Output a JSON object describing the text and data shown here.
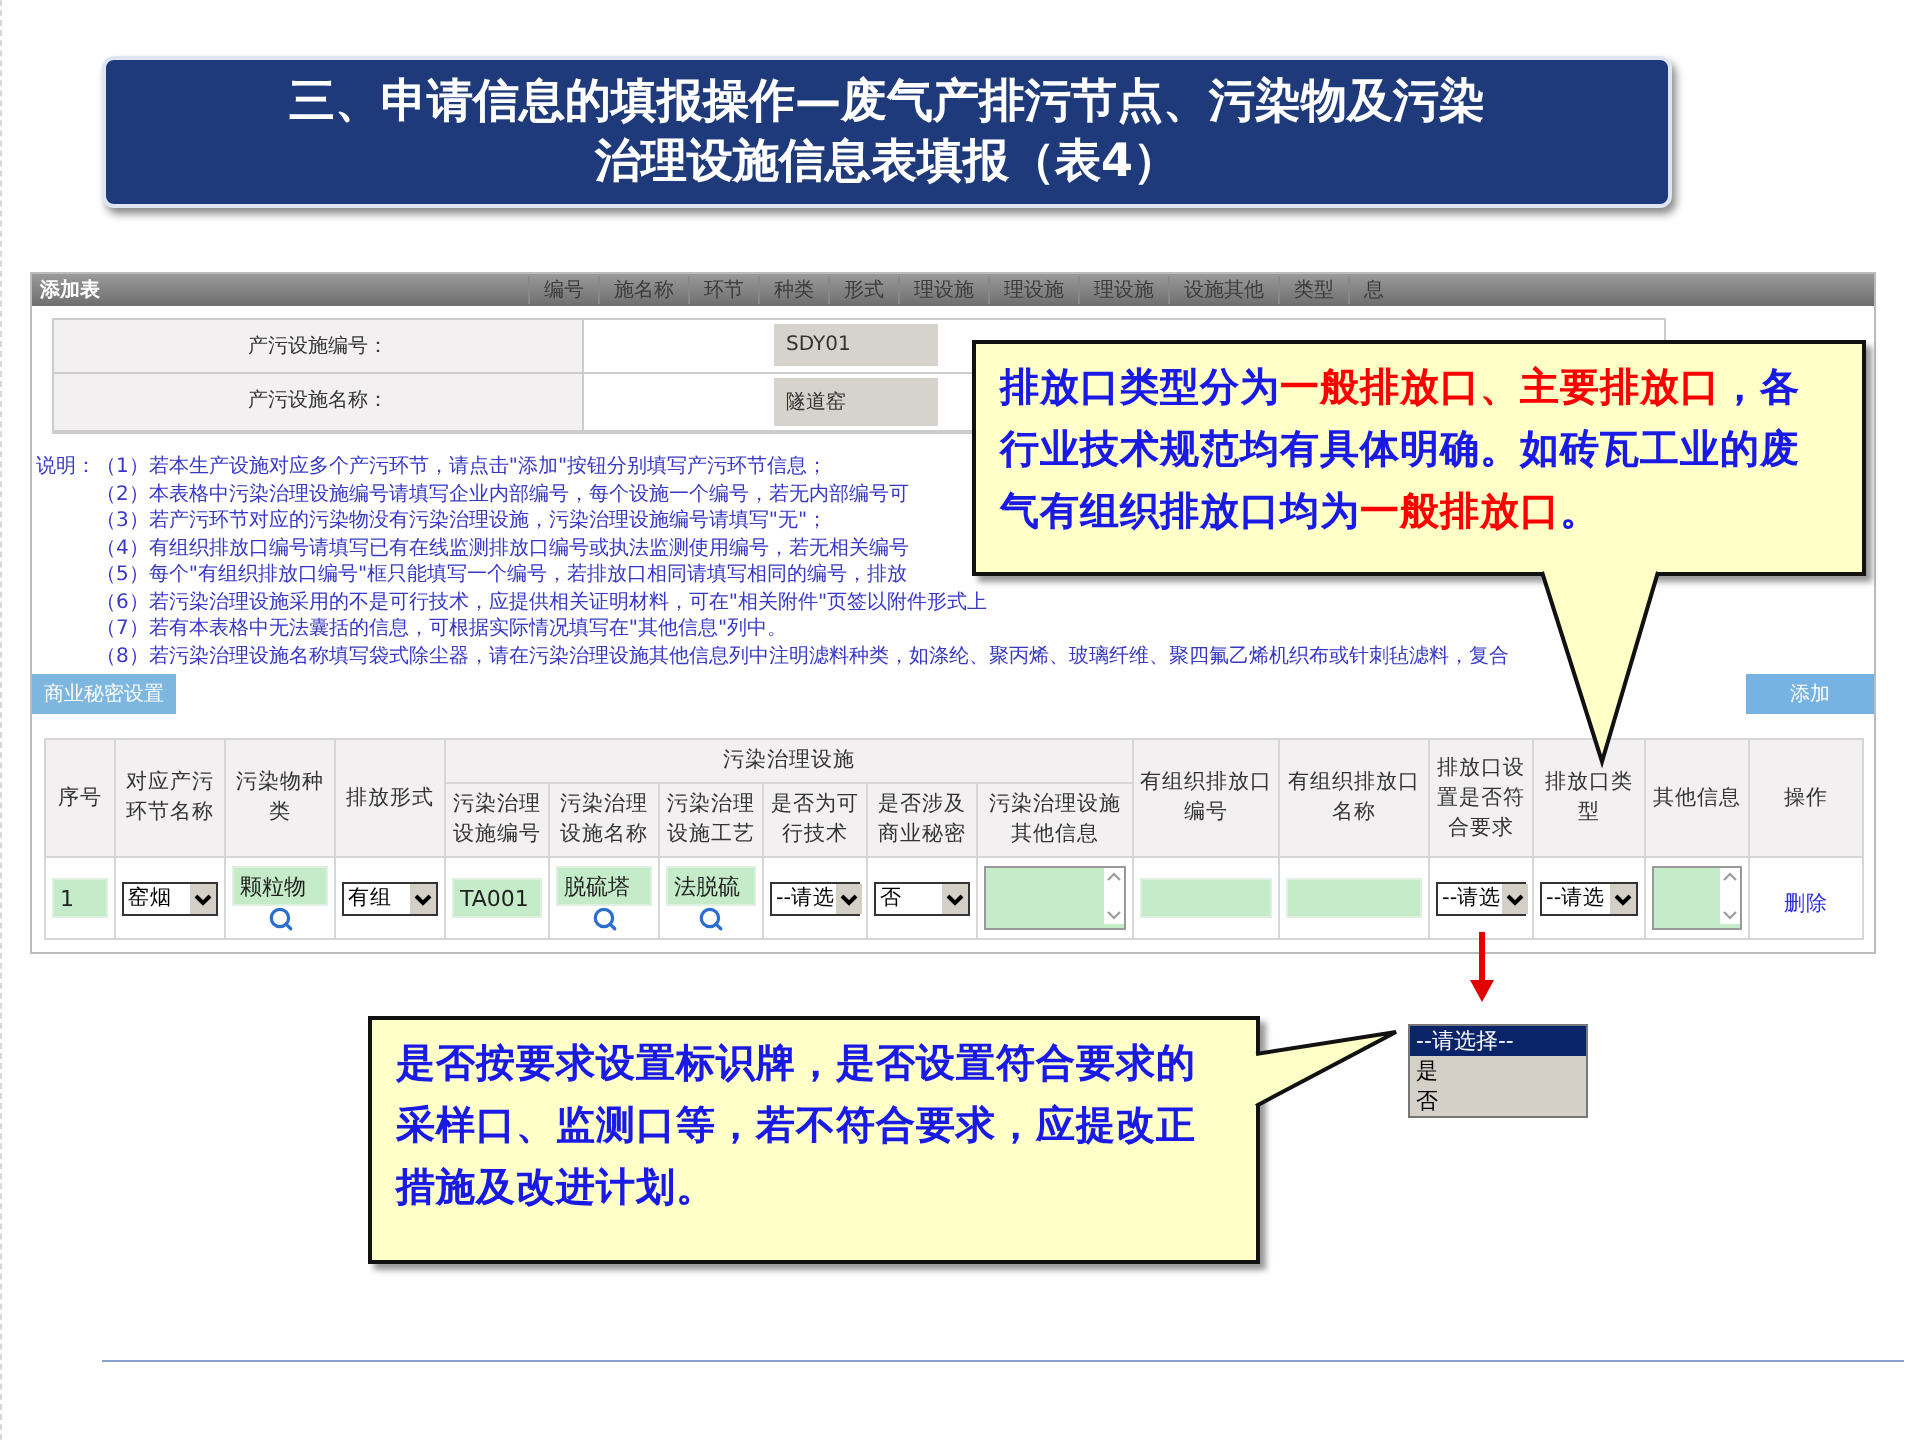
{
  "slide_title": {
    "lines": [
      "三、申请信息的填报操作—废气产排污节点、污染物及污染",
      "治理设施信息表填报（表4）"
    ]
  },
  "form_window": {
    "title": "添加表",
    "background_headers": [
      "编号",
      "施名称",
      "环节",
      "种类",
      "形式",
      "理设施",
      "理设施",
      "理设施",
      "设施其他",
      "类型",
      "息"
    ],
    "fields": [
      {
        "label": "产污设施编号：",
        "value": "SDY01"
      },
      {
        "label": "产污设施名称：",
        "value": "隧道窑"
      }
    ],
    "notes_label": "说明：",
    "notes": [
      "（1）若本生产设施对应多个产污环节，请点击\"添加\"按钮分别填写产污环节信息；",
      "（2）本表格中污染治理设施编号请填写企业内部编号，每个设施一个编号，若无内部编号可",
      "（3）若产污环节对应的污染物没有污染治理设施，污染治理设施编号请填写\"无\"；",
      "（4）有组织排放口编号请填写已有在线监测排放口编号或执法监测使用编号，若无相关编号",
      "（5）每个\"有组织排放口编号\"框只能填写一个编号，若排放口相同请填写相同的编号，排放",
      "（6）若污染治理设施采用的不是可行技术，应提供相关证明材料，可在\"相关附件\"页签以附件形式上",
      "（7）若有本表格中无法囊括的信息，可根据实际情况填写在\"其他信息\"列中。",
      "（8）若污染治理设施名称填写袋式除尘器，请在污染治理设施其他信息列中注明滤料种类，如涤纶、聚丙烯、玻璃纤维、聚四氟乙烯机织布或针刺毡滤料，复合"
    ],
    "left_button": "商业秘密设置",
    "right_button": "添加",
    "table": {
      "columns": [
        {
          "label": "序号"
        },
        {
          "label": "对应产污环节名称"
        },
        {
          "label": "污染物种类"
        },
        {
          "label": "排放形式"
        },
        {
          "label": "污染治理设施",
          "colspan": 6,
          "children": [
            "污染治理设施编号",
            "污染治理设施名称",
            "污染治理设施工艺",
            "是否为可行技术",
            "是否涉及商业秘密",
            "污染治理设施其他信息"
          ]
        },
        {
          "label": "有组织排放口编号"
        },
        {
          "label": "有组织排放口名称"
        },
        {
          "label": "排放口设置是否符合要求"
        },
        {
          "label": "排放口类型"
        },
        {
          "label": "其他信息"
        },
        {
          "label": "操作"
        }
      ],
      "rows": [
        {
          "cells": [
            {
              "kind": "input",
              "value": "1"
            },
            {
              "kind": "select",
              "value": "窑烟"
            },
            {
              "kind": "lookup",
              "value": "颗粒物"
            },
            {
              "kind": "select",
              "value": "有组"
            },
            {
              "kind": "input",
              "value": "TA001"
            },
            {
              "kind": "lookup",
              "value": "脱硫塔"
            },
            {
              "kind": "lookup",
              "value": "法脱硫"
            },
            {
              "kind": "select",
              "value": "--请选"
            },
            {
              "kind": "select",
              "value": "否"
            },
            {
              "kind": "textarea"
            },
            {
              "kind": "input"
            },
            {
              "kind": "input"
            },
            {
              "kind": "select",
              "value": "--请选"
            },
            {
              "kind": "select",
              "value": "--请选"
            },
            {
              "kind": "textarea"
            },
            {
              "kind": "link",
              "value": "删除"
            }
          ]
        }
      ]
    }
  },
  "dropdown_popup": {
    "options": [
      {
        "label": "--请选择--",
        "selected": true
      },
      {
        "label": "是",
        "selected": false
      },
      {
        "label": "否",
        "selected": false
      }
    ]
  },
  "callouts": [
    {
      "segments": [
        {
          "text": "排放口类型分为",
          "emphasis": false
        },
        {
          "text": "一般排放口、主要排放口",
          "emphasis": true
        },
        {
          "text": "，各行业技术规范均有具体明确。如砖瓦工业的废气有组织排放口均为",
          "emphasis": false
        },
        {
          "text": "一般排放口",
          "emphasis": true
        },
        {
          "text": "。",
          "emphasis": false
        }
      ]
    },
    {
      "segments": [
        {
          "text": "是否按要求设置标识牌，是否设置符合要求的采样口、监测口等，若不符合要求，应提改正措施及改进计划。",
          "emphasis": false
        }
      ]
    }
  ]
}
